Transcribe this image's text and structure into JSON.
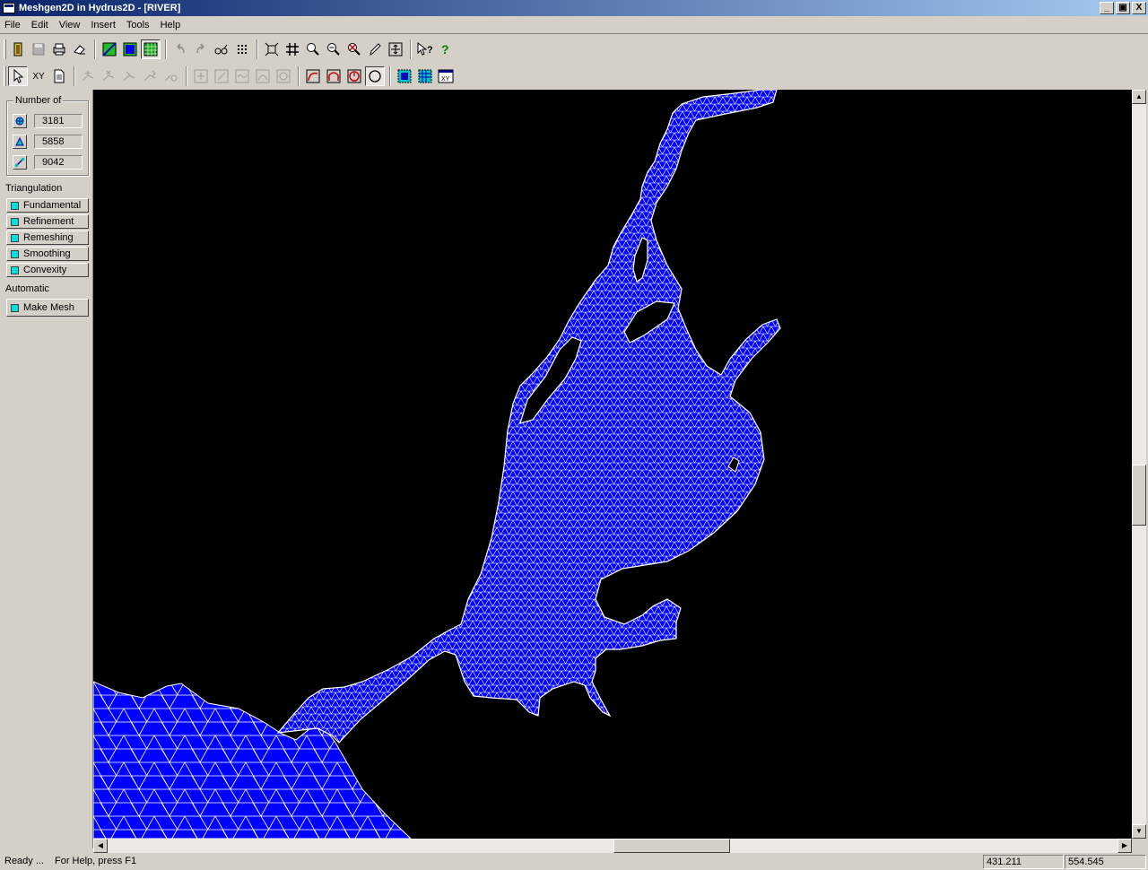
{
  "window": {
    "title": "Meshgen2D in Hydrus2D - [RIVER]",
    "controls": [
      "_",
      "▣",
      "X"
    ]
  },
  "menu": [
    "File",
    "Edit",
    "View",
    "Insert",
    "Tools",
    "Help"
  ],
  "toolbar1": {
    "icons": [
      "open-icon",
      "save-icon",
      "print-icon",
      "eraser-icon",
      "mesh-boundary-icon",
      "mesh-fill-icon",
      "mesh-grid-icon",
      "undo-icon",
      "redo-icon",
      "glasses-icon",
      "dots-grid-icon",
      "zoom-extents-icon",
      "zoom-grid-icon",
      "zoom-in-icon",
      "zoom-out-icon",
      "zoom-cancel-icon",
      "pencil-icon",
      "crosshair-box-icon",
      "context-help-icon",
      "help-icon"
    ]
  },
  "toolbar2": {
    "select_label": "XY",
    "icons": [
      "arrow-pointer-icon",
      "xy-icon",
      "document-icon",
      "node-tool-1-icon",
      "node-tool-2-icon",
      "node-tool-3-icon",
      "node-tool-4-icon",
      "node-tool-5-icon",
      "box-plus-icon",
      "box-slash-icon",
      "box-wave-icon",
      "box-arc-icon",
      "box-circle-icon",
      "curve-red-icon",
      "curve-arch-icon",
      "curve-round-icon",
      "circle-icon",
      "mesh-select-icon",
      "mesh-select-all-icon",
      "xy-window-icon"
    ]
  },
  "panel": {
    "number_of_label": "Number of",
    "counts": [
      {
        "icon": "node-icon",
        "value": "3181"
      },
      {
        "icon": "triangle-icon",
        "value": "5858"
      },
      {
        "icon": "edge-icon",
        "value": "9042"
      }
    ],
    "triangulation_label": "Triangulation",
    "triangulation_buttons": [
      "Fundamental",
      "Refinement",
      "Remeshing",
      "Smoothing",
      "Convexity"
    ],
    "automatic_label": "Automatic",
    "make_mesh_label": "Make Mesh"
  },
  "colors": {
    "mesh_fill": "#0000ff",
    "mesh_lines": "#ffffff",
    "background": "#000000",
    "accent_swatch": "#00e0e0"
  },
  "status": {
    "ready": "Ready ...",
    "help": "For Help, press F1",
    "coord_x": "431.211",
    "coord_y": "554.545"
  }
}
